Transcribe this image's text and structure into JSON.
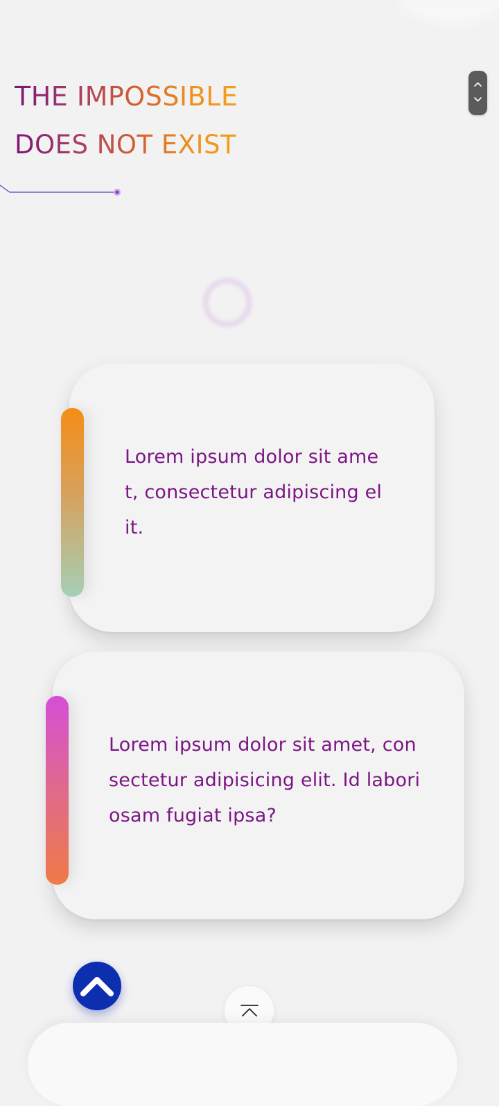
{
  "hero": {
    "title_line1": "THE IMPOSSIBLE",
    "title_line2": "DOES NOT EXIST"
  },
  "scroll_control": {
    "up_icon": "chevron-up-icon",
    "down_icon": "chevron-down-icon"
  },
  "cards": [
    {
      "text": "Lorem ipsum dolor sit amet, consectetur adipiscing elit."
    },
    {
      "text": "Lorem ipsum dolor sit amet, consectetur adipisicing elit. Id laboriosam fugiat ipsa?"
    }
  ],
  "buttons": {
    "back_to_top_icon": "chevron-up-icon",
    "scroll_top_icon": "arrow-to-top-icon"
  },
  "colors": {
    "title_gradient": [
      "#7b1774",
      "#d4602f",
      "#f39f1d"
    ],
    "card_text": "#7b1783",
    "card1_accent": [
      "#f58d17",
      "#a5cfb6"
    ],
    "card2_accent": [
      "#d64ed8",
      "#f07a46"
    ],
    "back_to_top_bg": "#0c2fb0",
    "page_bg": "#f3f2f3"
  }
}
